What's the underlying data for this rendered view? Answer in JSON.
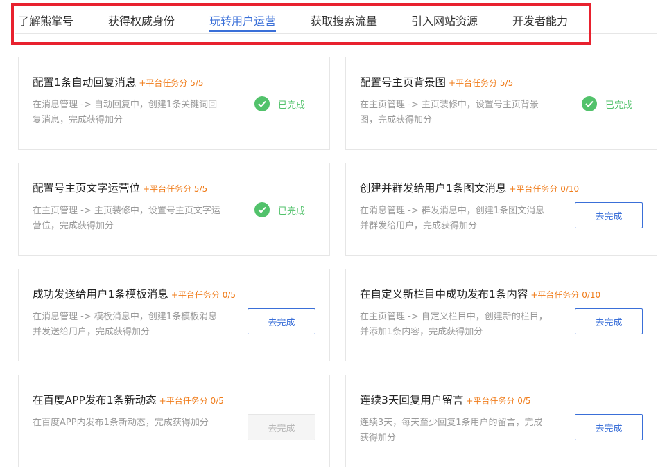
{
  "tabs": [
    {
      "label": "了解熊掌号"
    },
    {
      "label": "获得权威身份"
    },
    {
      "label": "玩转用户运营"
    },
    {
      "label": "获取搜索流量"
    },
    {
      "label": "引入网站资源"
    },
    {
      "label": "开发者能力"
    }
  ],
  "active_tab": "玩转用户运营",
  "colors": {
    "accent": "#3a6fd8",
    "success": "#52c26b",
    "points": "#f07c1a",
    "highlight": "#e8212e"
  },
  "tasks": [
    {
      "title": "配置1条自动回复消息",
      "points": "+平台任务分 5/5",
      "desc": "在消息管理 -> 自动回复中，创建1条关键词回复消息，完成获得加分",
      "status": "已完成"
    },
    {
      "title": "配置号主页背景图",
      "points": "+平台任务分 5/5",
      "desc": "在主页管理 -> 主页装修中，设置号主页背景图，完成获得加分",
      "status": "已完成"
    },
    {
      "title": "配置号主页文字运营位",
      "points": "+平台任务分 5/5",
      "desc": "在主页管理 -> 主页装修中，设置号主页文字运营位，完成获得加分",
      "status": "已完成"
    },
    {
      "title": "创建并群发给用户1条图文消息",
      "points": "+平台任务分 0/10",
      "desc": "在消息管理 -> 群发消息中，创建1条图文消息并群发给用户，完成获得加分",
      "button": "去完成"
    },
    {
      "title": "成功发送给用户1条模板消息",
      "points": "+平台任务分 0/5",
      "desc": "在消息管理 -> 模板消息中，创建1条模板消息并发送给用户，完成获得加分",
      "button": "去完成"
    },
    {
      "title": "在自定义新栏目中成功发布1条内容",
      "points": "+平台任务分 0/10",
      "desc": "在主页管理 -> 自定义栏目中，创建新的栏目，并添加1条内容，完成获得加分",
      "button": "去完成"
    },
    {
      "title": "在百度APP发布1条新动态",
      "points": "+平台任务分 0/5",
      "desc": "在百度APP内发布1条新动态，完成获得加分",
      "button": "去完成",
      "button_disabled": true
    },
    {
      "title": "连续3天回复用户留言",
      "points": "+平台任务分 0/5",
      "desc": "连续3天，每天至少回复1条用户的留言，完成获得加分",
      "button": "去完成"
    }
  ]
}
